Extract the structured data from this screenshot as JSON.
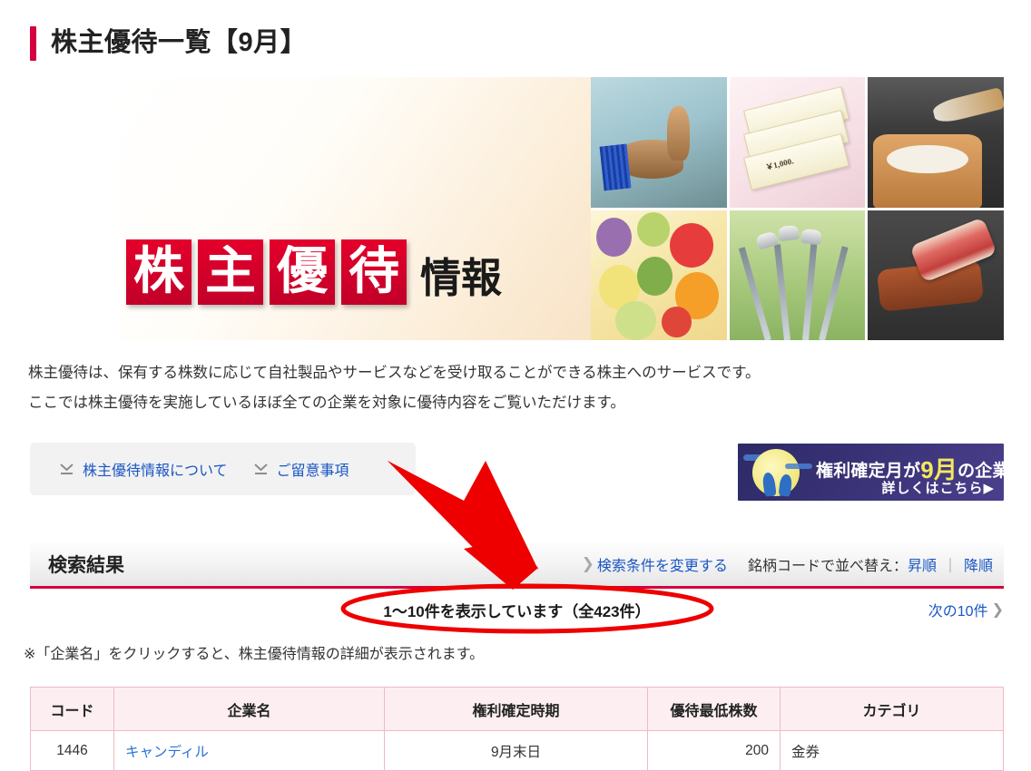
{
  "page": {
    "title": "株主優待一覧【9月】"
  },
  "hero": {
    "logo_chars": [
      "株",
      "主",
      "優",
      "待"
    ],
    "logo_suffix": "情報",
    "voucher_amount": "￥1,000.",
    "photos": [
      {
        "name": "onsen-photo",
        "alt": "温泉"
      },
      {
        "name": "gift-voucher-photo",
        "alt": "株主ご優待券"
      },
      {
        "name": "rice-photo",
        "alt": "お米"
      },
      {
        "name": "fruits-photo",
        "alt": "フルーツ"
      },
      {
        "name": "golf-photo",
        "alt": "ゴルフ"
      },
      {
        "name": "beef-photo",
        "alt": "お肉"
      }
    ]
  },
  "lead": {
    "line1": "株主優待は、保有する株数に応じて自社製品やサービスなどを受け取ることができる株主へのサービスです。",
    "line2": "ここでは株主優待を実施しているほぼ全ての企業を対象に優待内容をご覧いただけます。"
  },
  "info_box": {
    "links": [
      {
        "label": "株主優待情報について",
        "icon": "chevron-down-icon"
      },
      {
        "label": "ご留意事項",
        "icon": "chevron-down-icon"
      }
    ]
  },
  "ad_banner": {
    "text_before": "権利確定月が",
    "highlight": "9月",
    "text_after": "の企業",
    "cta": "詳しくはこちら▶"
  },
  "result_header": {
    "title": "検索結果",
    "change_condition": "検索条件を変更する",
    "sort_label": "銘柄コードで並べ替え：",
    "sort_asc": "昇順",
    "sort_sep": "｜",
    "sort_desc": "降順"
  },
  "count_row": {
    "text": "1～10件を表示しています（全423件）",
    "next_label": "次の10件",
    "next_chevron": "❯"
  },
  "note": {
    "text": "※「企業名」をクリックすると、株主優待情報の詳細が表示されます。"
  },
  "table": {
    "headers": [
      "コード",
      "企業名",
      "権利確定時期",
      "優待最低株数",
      "カテゴリ"
    ],
    "rows": [
      {
        "code": "1446",
        "company": "キャンディル",
        "period": "9月末日",
        "shares": "200",
        "category": "金券"
      }
    ]
  },
  "colors": {
    "accent_red": "#d40040",
    "link_blue": "#1a56c4",
    "company_link_blue": "#2b72d4",
    "table_header_pink": "#fdeff1",
    "table_border_pink": "#f0b9c6",
    "annotation_red": "#ee0000",
    "ad_highlight_yellow": "#f5e85c"
  }
}
